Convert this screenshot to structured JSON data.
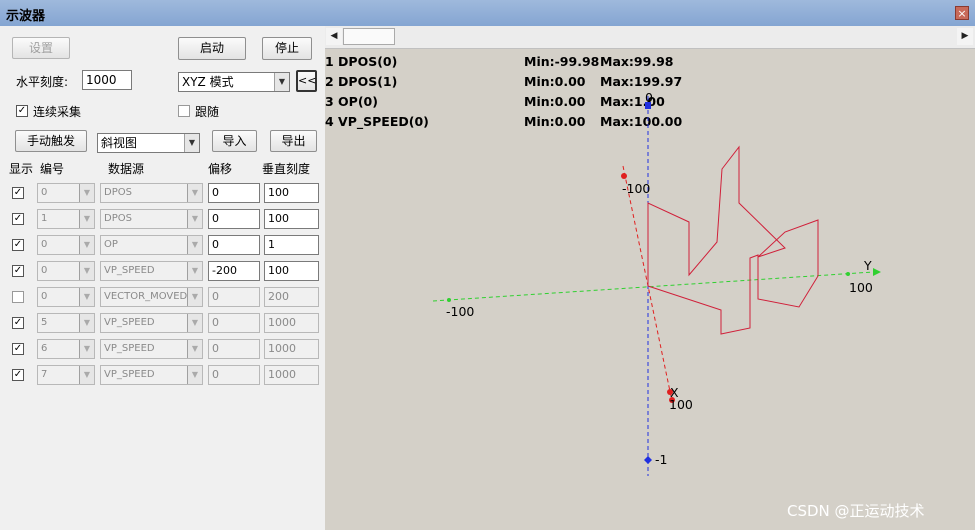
{
  "window": {
    "title": "示波器",
    "close_glyph": "×"
  },
  "controls": {
    "settings_label": "设置",
    "start_label": "启动",
    "stop_label": "停止",
    "h_scale_label": "水平刻度:",
    "h_scale_value": "1000",
    "mode_value": "XYZ 模式",
    "collapse_label": "<<",
    "continuous_label": "连续采集",
    "continuous_checked": true,
    "follow_label": "跟随",
    "follow_checked": false,
    "manual_trigger_label": "手动触发",
    "view_value": "斜视图",
    "import_label": "导入",
    "export_label": "导出"
  },
  "table": {
    "headers": {
      "show": "显示",
      "index": "编号",
      "source": "数据源",
      "offset": "偏移",
      "scale": "垂直刻度"
    },
    "rows": [
      {
        "checked": true,
        "index": "0",
        "source": "DPOS",
        "offset": "0",
        "scale": "100",
        "enabled": true
      },
      {
        "checked": true,
        "index": "1",
        "source": "DPOS",
        "offset": "0",
        "scale": "100",
        "enabled": true
      },
      {
        "checked": true,
        "index": "0",
        "source": "OP",
        "offset": "0",
        "scale": "1",
        "enabled": true
      },
      {
        "checked": true,
        "index": "0",
        "source": "VP_SPEED",
        "offset": "-200",
        "scale": "100",
        "enabled": true
      },
      {
        "checked": false,
        "index": "0",
        "source": "VECTOR_MOVED",
        "offset": "0",
        "scale": "200",
        "enabled": false
      },
      {
        "checked": true,
        "index": "5",
        "source": "VP_SPEED",
        "offset": "0",
        "scale": "1000",
        "enabled": false
      },
      {
        "checked": true,
        "index": "6",
        "source": "VP_SPEED",
        "offset": "0",
        "scale": "1000",
        "enabled": false
      },
      {
        "checked": true,
        "index": "7",
        "source": "VP_SPEED",
        "offset": "0",
        "scale": "1000",
        "enabled": false
      }
    ]
  },
  "plot": {
    "channel_info": [
      {
        "name": "1 DPOS(0)",
        "min": "Min:-99.98",
        "max": "Max:99.98"
      },
      {
        "name": "2 DPOS(1)",
        "min": "Min:0.00",
        "max": "Max:199.97"
      },
      {
        "name": "3 OP(0)",
        "min": "Min:0.00",
        "max": "Max:1.00"
      },
      {
        "name": "4 VP_SPEED(0)",
        "min": "Min:0.00",
        "max": "Max:100.00"
      }
    ],
    "axis_labels": {
      "x_neg": "-100",
      "x_pos": "100",
      "x_name": "X",
      "y_neg": "-100",
      "y_pos": "100",
      "y_name": "Y",
      "z_pos": "0",
      "z_neg": "-1"
    },
    "colors": {
      "trace": "#d0203a",
      "x_axis": "#e02020",
      "y_axis": "#30d030",
      "z_axis": "#2030e0"
    }
  },
  "watermark": "CSDN @正运动技术"
}
